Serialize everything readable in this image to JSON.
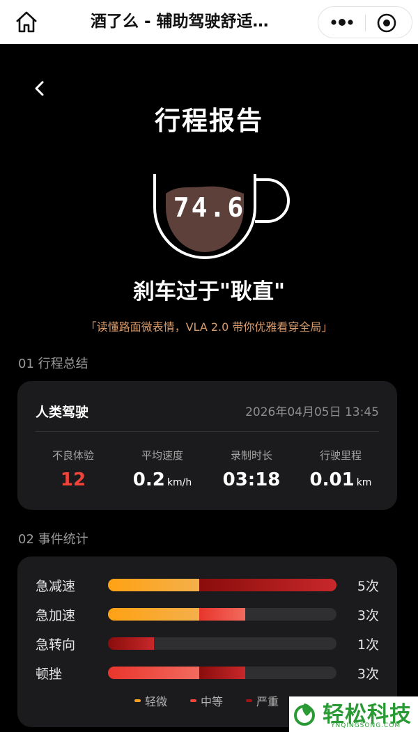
{
  "topbar": {
    "title": "酒了么 - 辅助驾驶舒适…",
    "home_icon": "home-icon",
    "more_icon": "more-dots-icon",
    "close_icon": "miniprogram-close-icon"
  },
  "header": {
    "back_icon": "chevron-left-icon",
    "title": "行程报告"
  },
  "score": {
    "value": "74.6",
    "verdict": "刹车过于\"耿直\"",
    "slogan": "「读懂路面微表情，VLA 2.0 带你优雅看穿全局」"
  },
  "summary": {
    "section_title": "01 行程总结",
    "mode": "人类驾驶",
    "datetime": "2026年04月05日 13:45",
    "stats": [
      {
        "label": "不良体验",
        "value": "12",
        "unit": ""
      },
      {
        "label": "平均速度",
        "value": "0.2",
        "unit": "km/h"
      },
      {
        "label": "录制时长",
        "value": "03:18",
        "unit": ""
      },
      {
        "label": "行驶里程",
        "value": "0.01",
        "unit": "km"
      }
    ]
  },
  "events": {
    "section_title": "02 事件统计",
    "max_count": 5,
    "items": [
      {
        "label": "急减速",
        "count_text": "5次",
        "mild": 2,
        "medium": 0,
        "severe": 3
      },
      {
        "label": "急加速",
        "count_text": "3次",
        "mild": 2,
        "medium": 1,
        "severe": 0
      },
      {
        "label": "急转向",
        "count_text": "1次",
        "mild": 0,
        "medium": 0,
        "severe": 1
      },
      {
        "label": "顿挫",
        "count_text": "3次",
        "mild": 0,
        "medium": 2,
        "severe": 1
      }
    ],
    "legend": [
      {
        "label": "轻微",
        "color": "#f6a121"
      },
      {
        "label": "中等",
        "color": "#f0433a"
      },
      {
        "label": "严重",
        "color": "#a01414"
      }
    ]
  },
  "watermark": {
    "title": "轻松科技",
    "sub": "YNQINGSONG.COM"
  },
  "colors": {
    "accent_orange": "#d89b6b",
    "danger_red": "#f0433a",
    "coffee_brown": "#5c4039"
  }
}
